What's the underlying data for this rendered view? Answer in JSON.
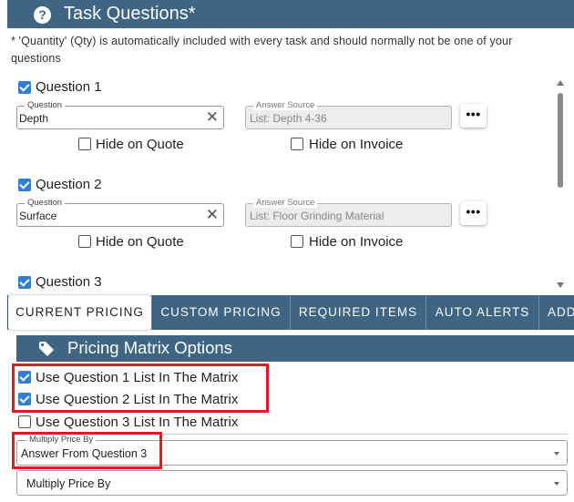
{
  "header": {
    "icon": "question-circle-icon",
    "icon_glyph": "?",
    "title": "Task Questions*"
  },
  "note": "* 'Quantity' (Qty) is automatically included with every task and should normally not be one of your questions",
  "questions": [
    {
      "label": "Question 1",
      "checked": true,
      "question_legend": "Question",
      "question_value": "Depth",
      "source_legend": "Answer Source",
      "source_value": "List: Depth 4-36",
      "more_label": "•••",
      "hide_quote": "Hide on Quote",
      "hide_invoice": "Hide on Invoice"
    },
    {
      "label": "Question 2",
      "checked": true,
      "question_legend": "Question",
      "question_value": "Surface",
      "source_legend": "Answer Source",
      "source_value": "List: Floor Grinding Material",
      "more_label": "•••",
      "hide_quote": "Hide on Quote",
      "hide_invoice": "Hide on Invoice"
    },
    {
      "label": "Question 3",
      "checked": true
    }
  ],
  "clear_glyph": "✕",
  "tabs": [
    "CURRENT PRICING",
    "CUSTOM PRICING",
    "REQUIRED ITEMS",
    "AUTO ALERTS",
    "ADD"
  ],
  "active_tab": "CURRENT PRICING",
  "pricing_matrix": {
    "icon": "tag-icon",
    "title": "Pricing Matrix Options",
    "options": [
      {
        "label": "Use Question 1 List In The Matrix",
        "checked": true
      },
      {
        "label": "Use Question 2 List In The Matrix",
        "checked": true
      },
      {
        "label": "Use Question 3 List In The Matrix",
        "checked": false
      }
    ],
    "multiply_1": {
      "legend": "Multiply Price By",
      "value": "Answer From Question 3"
    },
    "multiply_2": {
      "value": "Multiply Price By"
    }
  },
  "colors": {
    "header_bg": "#3e6684",
    "checkbox_blue": "#2f7fd2",
    "highlight_red": "#e11b22"
  }
}
